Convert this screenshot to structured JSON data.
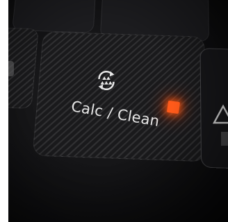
{
  "panel": {
    "button_label": "Calc / Clean",
    "icon": "calc-clean-icon",
    "indicator": {
      "state": "on",
      "color": "#ff5a1a"
    },
    "side_icon": "warning-triangle-icon"
  }
}
